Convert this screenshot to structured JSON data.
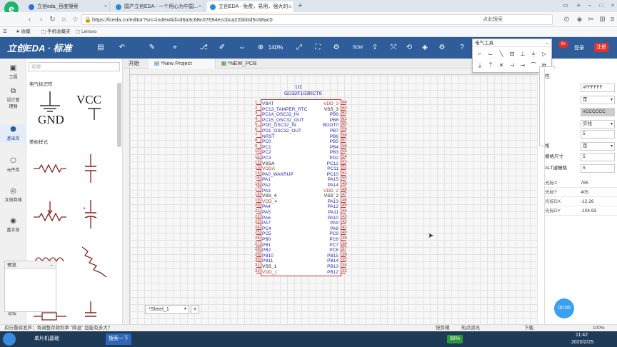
{
  "browser": {
    "tabs": [
      {
        "title": "立创eda_百度搜索",
        "active": false
      },
      {
        "title": "国产立创EDA - 一个用心为中国...",
        "active": false
      },
      {
        "title": "立创EDA - 免费，易用，强大的...",
        "active": true
      }
    ],
    "url": "https://lceda.cn/editor?src=index#id=d6a3c68c07694eccbca22bb0d5c68ac0",
    "right_label": "点此搜索",
    "bookmarks": [
      "收藏",
      "手机收藏夹",
      "Lenovo"
    ]
  },
  "eda": {
    "logo": "立创EDA · 标准",
    "zoom": "140%",
    "bom_label": "BOM",
    "notification_count": "9+",
    "login": "登录",
    "register": "注册"
  },
  "rail": [
    {
      "label": "工程",
      "icon": "folder-icon"
    },
    {
      "label": "设计管理器",
      "icon": "design-manager-icon"
    },
    {
      "label": "基础库",
      "icon": "basic-library-icon",
      "active": true
    },
    {
      "label": "元件库",
      "icon": "component-library-icon"
    },
    {
      "label": "立创商城",
      "icon": "lcsc-mall-icon"
    },
    {
      "label": "嘉立创",
      "icon": "jlc-icon"
    }
  ],
  "library": {
    "search_placeholder": "过滤",
    "section1": "电气标识符",
    "section2": "美标样式",
    "gnd": "GND",
    "vcc": "VCC",
    "preview_title": "预览",
    "bottom_label": "提取"
  },
  "editor": {
    "tabs": [
      "开始",
      "*New Project",
      "*NEW_PCB"
    ],
    "sheet": "*Sheet_1",
    "sheet_add": "+"
  },
  "chip": {
    "ref": "U1",
    "part": "GD32F103RCT6",
    "left_pins": [
      {
        "num": "1",
        "name": "VBAT"
      },
      {
        "num": "2",
        "name": "PC13_TAMPER_RTC"
      },
      {
        "num": "3",
        "name": "PC14_OSC32_IN"
      },
      {
        "num": "4",
        "name": "PC15_OSC32_OUT"
      },
      {
        "num": "5",
        "name": "PD0_OSC32_IN"
      },
      {
        "num": "6",
        "name": "PD1_OSC32_OUT"
      },
      {
        "num": "7",
        "name": "NRST"
      },
      {
        "num": "8",
        "name": "PC0"
      },
      {
        "num": "9",
        "name": "PC1"
      },
      {
        "num": "10",
        "name": "PC2"
      },
      {
        "num": "11",
        "name": "PC3"
      },
      {
        "num": "12",
        "name": "VSSA"
      },
      {
        "num": "13",
        "name": "VDDA"
      },
      {
        "num": "14",
        "name": "PA0_WAKRUP"
      },
      {
        "num": "15",
        "name": "PA1"
      },
      {
        "num": "16",
        "name": "PA2"
      },
      {
        "num": "17",
        "name": "PA3"
      },
      {
        "num": "18",
        "name": "VSS_4"
      },
      {
        "num": "19",
        "name": "VDD_4"
      },
      {
        "num": "20",
        "name": "PA4"
      },
      {
        "num": "21",
        "name": "PA5"
      },
      {
        "num": "22",
        "name": "PA6"
      },
      {
        "num": "23",
        "name": "PA7"
      },
      {
        "num": "24",
        "name": "PC4"
      },
      {
        "num": "25",
        "name": "PC5"
      },
      {
        "num": "26",
        "name": "PB0"
      },
      {
        "num": "27",
        "name": "PB1"
      },
      {
        "num": "28",
        "name": "PB2"
      },
      {
        "num": "29",
        "name": "PB10"
      },
      {
        "num": "30",
        "name": "PB11"
      },
      {
        "num": "31",
        "name": "VSS_1"
      },
      {
        "num": "32",
        "name": "VDD_1"
      }
    ],
    "right_pins": [
      {
        "num": "64",
        "name": "VDD_3"
      },
      {
        "num": "63",
        "name": "VSS_3"
      },
      {
        "num": "62",
        "name": "PB9"
      },
      {
        "num": "61",
        "name": "PB8"
      },
      {
        "num": "60",
        "name": "BOOT0"
      },
      {
        "num": "59",
        "name": "PB7"
      },
      {
        "num": "58",
        "name": "PB6"
      },
      {
        "num": "57",
        "name": "PB5"
      },
      {
        "num": "56",
        "name": "PB4"
      },
      {
        "num": "55",
        "name": "PB3"
      },
      {
        "num": "54",
        "name": "PD2"
      },
      {
        "num": "53",
        "name": "PC12"
      },
      {
        "num": "52",
        "name": "PC11"
      },
      {
        "num": "51",
        "name": "PC10"
      },
      {
        "num": "50",
        "name": "PA15"
      },
      {
        "num": "49",
        "name": "PA14"
      },
      {
        "num": "48",
        "name": "VDD_2"
      },
      {
        "num": "47",
        "name": "VSS_2"
      },
      {
        "num": "46",
        "name": "PA13"
      },
      {
        "num": "45",
        "name": "PA12"
      },
      {
        "num": "44",
        "name": "PA11"
      },
      {
        "num": "43",
        "name": "PA10"
      },
      {
        "num": "42",
        "name": "PA9"
      },
      {
        "num": "41",
        "name": "PA8"
      },
      {
        "num": "40",
        "name": "PC9"
      },
      {
        "num": "39",
        "name": "PC8"
      },
      {
        "num": "38",
        "name": "PC7"
      },
      {
        "num": "37",
        "name": "PC6"
      },
      {
        "num": "36",
        "name": "PB15"
      },
      {
        "num": "35",
        "name": "PB14"
      },
      {
        "num": "34",
        "name": "PB13"
      },
      {
        "num": "33",
        "name": "PB12"
      }
    ]
  },
  "etools_title": "电气工具",
  "props": {
    "title_partial": "性",
    "bg_color": "#FFFFFF",
    "grid_visible": "是",
    "grid_color": "#CCCCCC",
    "grid_style": "实线",
    "grid_size": "5",
    "snap": "是",
    "snap_size_label": "栅格尺寸",
    "snap_size": "5",
    "alt_label": "ALT键栅格",
    "alt_size": "5",
    "label_snap": "格",
    "cursor": [
      {
        "label": "光标X",
        "value": "785"
      },
      {
        "label": "光标Y",
        "value": "405"
      },
      {
        "label": "光标DX",
        "value": "-12.26"
      },
      {
        "label": "光标DY",
        "value": "-104.93"
      }
    ]
  },
  "timer": "00:00",
  "status": {
    "left": "央行重磅发声：将调整存款利率 \"降息\" 您能有多大？",
    "quick_clip": "快剪辑",
    "hot": "热点资讯",
    "download": "下载",
    "zoom": "100%"
  },
  "taskbar": {
    "app": "单片机基础",
    "search": "搜索一下",
    "battery": "99%",
    "time": "11:42",
    "date": "2020/2/25"
  },
  "colors": {
    "toolbar": "#2e5d9a",
    "pin_red": "#b33333",
    "pin_name": "#2a2aa8",
    "register": "#e0312a"
  }
}
